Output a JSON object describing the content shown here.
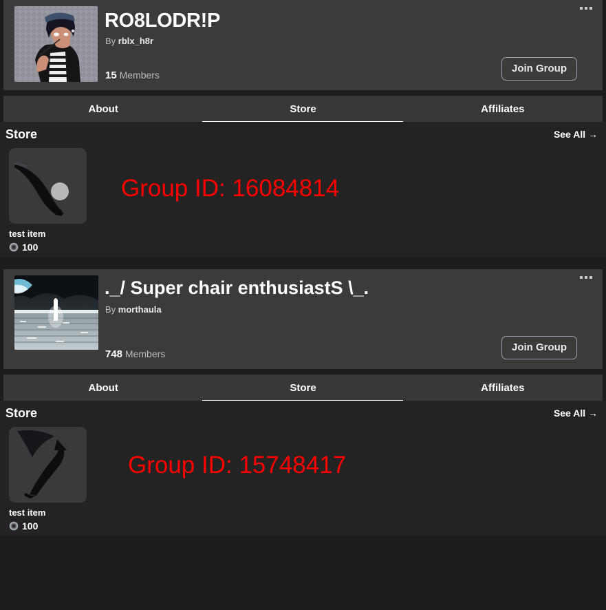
{
  "groups": [
    {
      "title": "RO8LODR!P",
      "by_prefix": "By ",
      "author": "rblx_h8r",
      "member_count": "15",
      "member_label": "Members",
      "join_label": "Join Group",
      "menu_icon": "ellipsis-icon",
      "avatar_icon": "group-avatar-anime-character",
      "tabs": [
        {
          "label": "About",
          "active": false
        },
        {
          "label": "Store",
          "active": true
        },
        {
          "label": "Affiliates",
          "active": false
        }
      ],
      "store": {
        "heading": "Store",
        "see_all": "See All →",
        "items": [
          {
            "name": "test item",
            "price": "100",
            "currency_icon": "robux-icon",
            "thumb_icon": "item-thumbnail-curve-sphere"
          }
        ]
      },
      "annotation": "Group ID: 16084814"
    },
    {
      "title": "._/ Super chair enthusiastS \\_.",
      "by_prefix": "By ",
      "author": "morthaula",
      "member_count": "748",
      "member_label": "Members",
      "join_label": "Join Group",
      "menu_icon": "ellipsis-icon",
      "avatar_icon": "group-avatar-stormy-beach",
      "tabs": [
        {
          "label": "About",
          "active": false
        },
        {
          "label": "Store",
          "active": true
        },
        {
          "label": "Affiliates",
          "active": false
        }
      ],
      "store": {
        "heading": "Store",
        "see_all": "See All →",
        "items": [
          {
            "name": "test item",
            "price": "100",
            "currency_icon": "robux-icon",
            "thumb_icon": "item-thumbnail-hook-curve"
          }
        ]
      },
      "annotation": "Group ID: 15748417"
    }
  ],
  "colors": {
    "page_background": "#1d1d1d",
    "header_card": "#3b3b3b",
    "tab_bar": "#383838",
    "store_background": "#232323",
    "annotation_red": "#fe0000",
    "text_primary": "#ffffff",
    "text_secondary": "#b9bcc0",
    "button_border": "#9aa0a6"
  }
}
